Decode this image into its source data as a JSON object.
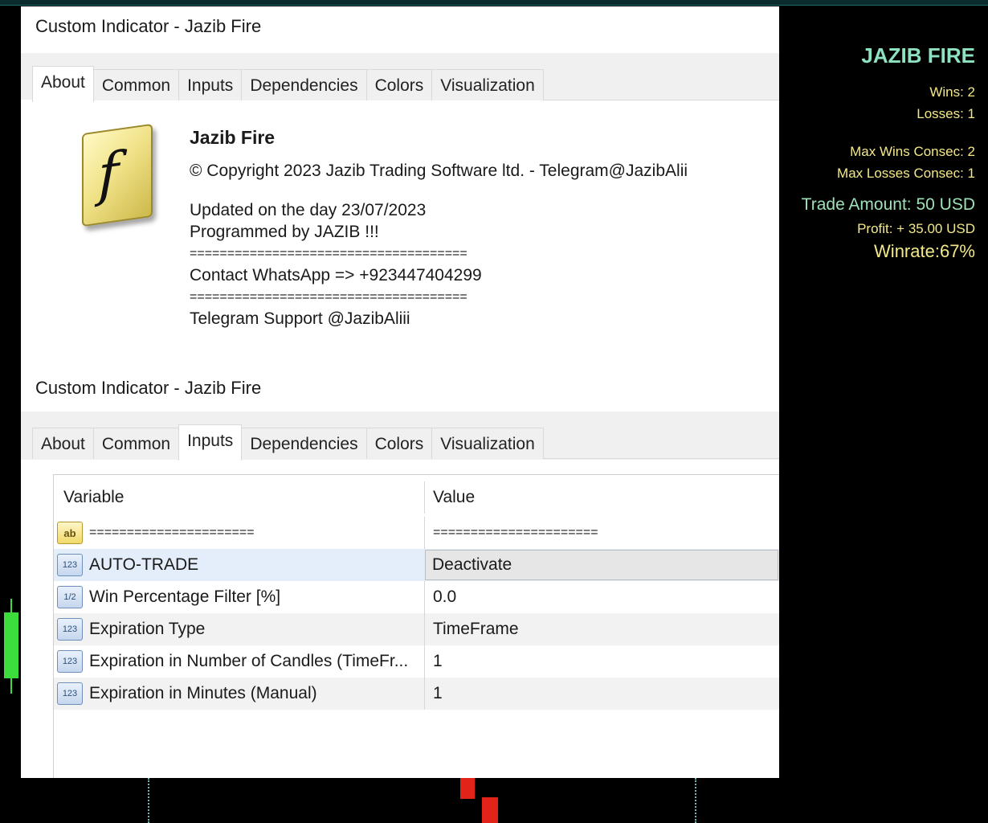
{
  "stats": {
    "title": "JAZIB FIRE",
    "wins": "Wins: 2",
    "losses": "Losses: 1",
    "max_wins": "Max Wins Consec: 2",
    "max_losses": "Max Losses Consec: 1",
    "trade_amount": "Trade Amount: 50 USD",
    "profit": "Profit: + 35.00 USD",
    "winrate": "Winrate:67%"
  },
  "dialog_about": {
    "title": "Custom Indicator - Jazib Fire",
    "tabs": [
      "About",
      "Common",
      "Inputs",
      "Dependencies",
      "Colors",
      "Visualization"
    ],
    "logo_letter": "f",
    "name": "Jazib Fire",
    "copyright": "© Copyright 2023 Jazib Trading Software ltd. - Telegram@JazibAlii",
    "updated": "Updated on the day 23/07/2023",
    "programmed": "Programmed by JAZIB !!!",
    "separator": "=====================================",
    "whatsapp": "Contact WhatsApp => +923447404299",
    "telegram": "Telegram Support @JazibAliii"
  },
  "dialog_inputs": {
    "title": "Custom Indicator - Jazib Fire",
    "tabs": [
      "About",
      "Common",
      "Inputs",
      "Dependencies",
      "Colors",
      "Visualization"
    ],
    "columns": [
      "Variable",
      "Value"
    ],
    "rows": [
      {
        "icon": "ab",
        "variable": "======================",
        "value": "======================"
      },
      {
        "icon": "123",
        "variable": "AUTO-TRADE",
        "value": "Deactivate"
      },
      {
        "icon": "1/2",
        "variable": "Win Percentage Filter [%]",
        "value": "0.0"
      },
      {
        "icon": "123",
        "variable": "Expiration Type",
        "value": "TimeFrame"
      },
      {
        "icon": "123",
        "variable": "Expiration in Number of Candles (TimeFr...",
        "value": "1"
      },
      {
        "icon": "123",
        "variable": "Expiration in Minutes (Manual)",
        "value": "1"
      }
    ]
  },
  "colors": {
    "stats_title": "#8de3c0",
    "stats_text": "#f3e88a",
    "candle_up": "#3ddc3d",
    "candle_down": "#e2231a"
  }
}
